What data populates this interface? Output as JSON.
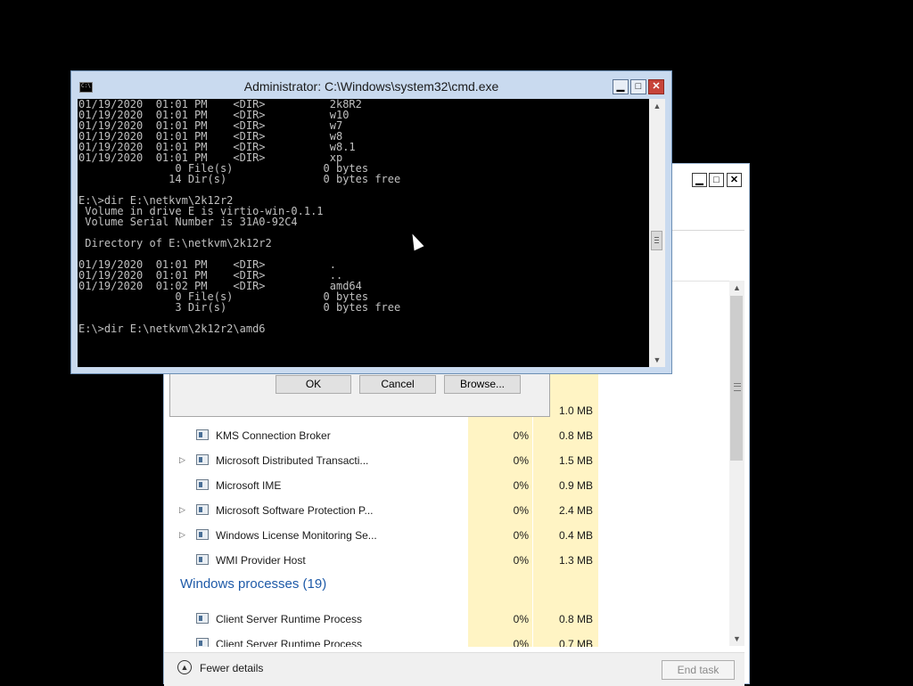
{
  "task_manager": {
    "controls": {
      "minimize": "▁",
      "maximize": "□",
      "close": "✕"
    },
    "rows": [
      {
        "name": "",
        "cpu": "",
        "mem": "1.0 MB",
        "expandable": false,
        "icon": "service-icon"
      },
      {
        "name": "KMS Connection Broker",
        "cpu": "0%",
        "mem": "0.8 MB",
        "expandable": false,
        "icon": "service-icon"
      },
      {
        "name": "Microsoft Distributed Transacti...",
        "cpu": "0%",
        "mem": "1.5 MB",
        "expandable": true,
        "icon": "network-icon"
      },
      {
        "name": "Microsoft IME",
        "cpu": "0%",
        "mem": "0.9 MB",
        "expandable": false,
        "icon": "service-icon"
      },
      {
        "name": "Microsoft Software Protection P...",
        "cpu": "0%",
        "mem": "2.4 MB",
        "expandable": true,
        "icon": "service-icon"
      },
      {
        "name": "Windows License Monitoring Se...",
        "cpu": "0%",
        "mem": "0.4 MB",
        "expandable": true,
        "icon": "service-icon"
      },
      {
        "name": "WMI Provider Host",
        "cpu": "0%",
        "mem": "1.3 MB",
        "expandable": false,
        "icon": "wmi-icon"
      }
    ],
    "group": "Windows processes (19)",
    "rows2": [
      {
        "name": "Client Server Runtime Process",
        "cpu": "0%",
        "mem": "0.8 MB"
      },
      {
        "name": "Client Server Runtime Process",
        "cpu": "0%",
        "mem": "0.7 MB"
      }
    ],
    "footer": {
      "fewer_details": "Fewer details",
      "end_task": "End task"
    }
  },
  "dialog": {
    "ok": "OK",
    "cancel": "Cancel",
    "browse": "Browse..."
  },
  "cmd": {
    "title": "Administrator: C:\\Windows\\system32\\cmd.exe",
    "icon_text": "C:\\",
    "controls": {
      "minimize": "▁",
      "maximize": "□",
      "close": "✕"
    },
    "lines": [
      "01/19/2020  01:01 PM    <DIR>          2k8R2",
      "01/19/2020  01:01 PM    <DIR>          w10",
      "01/19/2020  01:01 PM    <DIR>          w7",
      "01/19/2020  01:01 PM    <DIR>          w8",
      "01/19/2020  01:01 PM    <DIR>          w8.1",
      "01/19/2020  01:01 PM    <DIR>          xp",
      "               0 File(s)              0 bytes",
      "              14 Dir(s)               0 bytes free",
      "",
      "E:\\>dir E:\\netkvm\\2k12r2",
      " Volume in drive E is virtio-win-0.1.1",
      " Volume Serial Number is 31A0-92C4",
      "",
      " Directory of E:\\netkvm\\2k12r2",
      "",
      "01/19/2020  01:01 PM    <DIR>          .",
      "01/19/2020  01:01 PM    <DIR>          ..",
      "01/19/2020  01:02 PM    <DIR>          amd64",
      "               0 File(s)              0 bytes",
      "               3 Dir(s)               0 bytes free",
      "",
      "E:\\>dir E:\\netkvm\\2k12r2\\amd6"
    ]
  }
}
